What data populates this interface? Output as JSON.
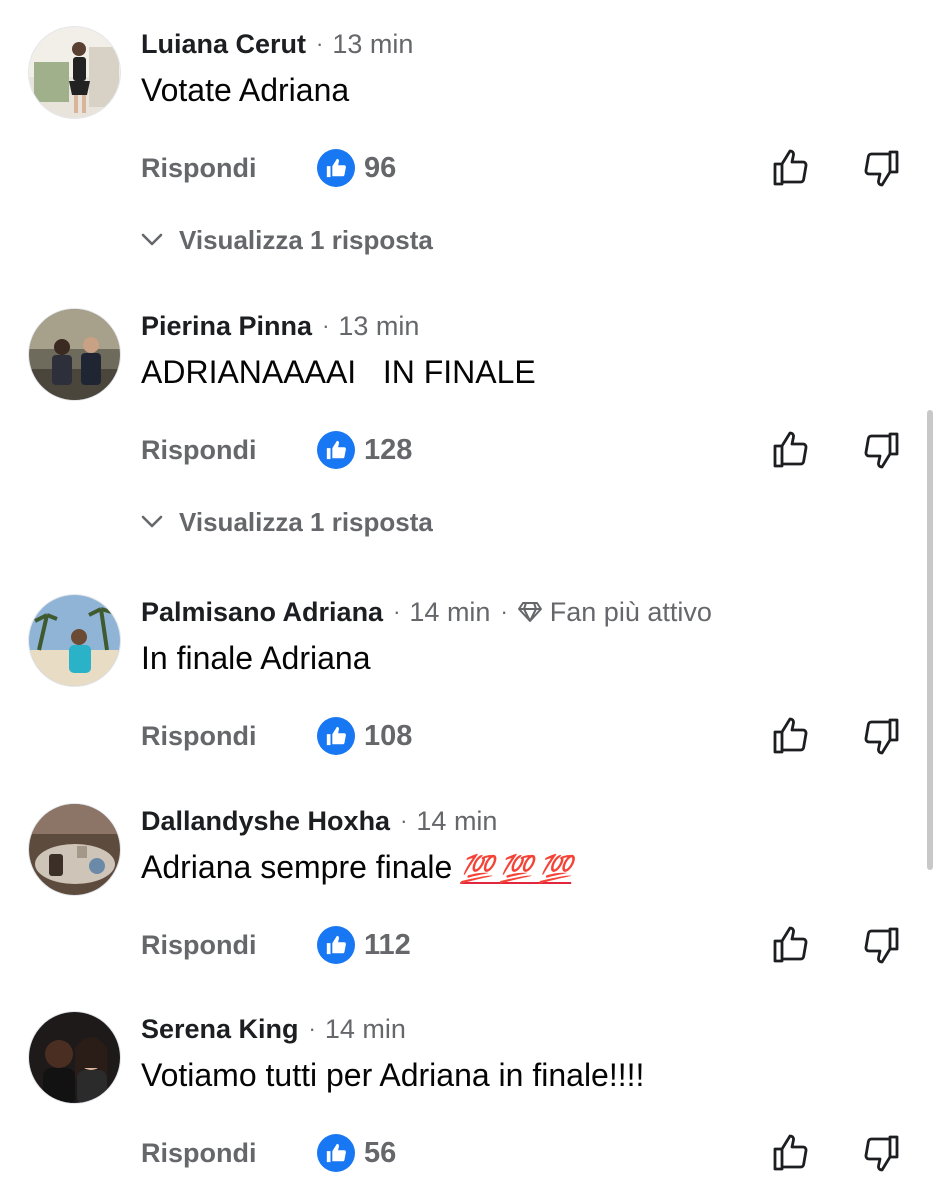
{
  "comments": [
    {
      "author": "Luiana Cerut",
      "time": "13 min",
      "text": "Votate Adriana",
      "reply_label": "Rispondi",
      "likes": "96",
      "replies_label": "Visualizza 1 risposta"
    },
    {
      "author": "Pierina Pinna",
      "time": "13 min",
      "text": "ADRIANAAAAI   IN FINALE",
      "reply_label": "Rispondi",
      "likes": "128",
      "replies_label": "Visualizza 1 risposta"
    },
    {
      "author": "Palmisano Adriana",
      "time": "14 min",
      "badge": "Fan più attivo",
      "badge_icon": "diamond-icon",
      "text": "In finale Adriana",
      "reply_label": "Rispondi",
      "likes": "108"
    },
    {
      "author": "Dallandyshe Hoxha",
      "time": "14 min",
      "text": "Adriana sempre finale",
      "emoji": "💯 💯 💯",
      "reply_label": "Rispondi",
      "likes": "112"
    },
    {
      "author": "Serena King",
      "time": "14 min",
      "text": "Votiamo tutti per Adriana in finale!!!!",
      "reply_label": "Rispondi",
      "likes": "56"
    }
  ],
  "colors": {
    "like_badge": "#1877f2",
    "secondary_text": "#65676b",
    "primary_text": "#050505"
  },
  "icons": [
    "like-badge-icon",
    "thumbs-up-icon",
    "thumbs-down-icon",
    "chevron-down-icon",
    "diamond-icon"
  ]
}
